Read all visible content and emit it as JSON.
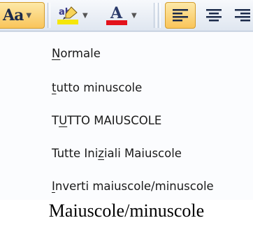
{
  "toolbar": {
    "change_case_label": "Aa",
    "highlight_icon_text": "ab",
    "font_color_label": "A",
    "highlight_color": "#f5e60a",
    "font_color": "#e3121b",
    "active_button_color": "#f9c55a"
  },
  "menu": {
    "items": [
      {
        "pre": "",
        "ul": "N",
        "post": "ormale"
      },
      {
        "pre": "",
        "ul": "t",
        "post": "utto minuscole"
      },
      {
        "pre": "T",
        "ul": "U",
        "post": "TTO MAIUSCOLE"
      },
      {
        "pre": "Tutte Ini",
        "ul": "z",
        "post": "iali Maiuscole"
      },
      {
        "pre": "",
        "ul": "I",
        "post": "nverti maiuscole/minuscole"
      }
    ]
  },
  "caption": "Maiuscole/minuscole"
}
